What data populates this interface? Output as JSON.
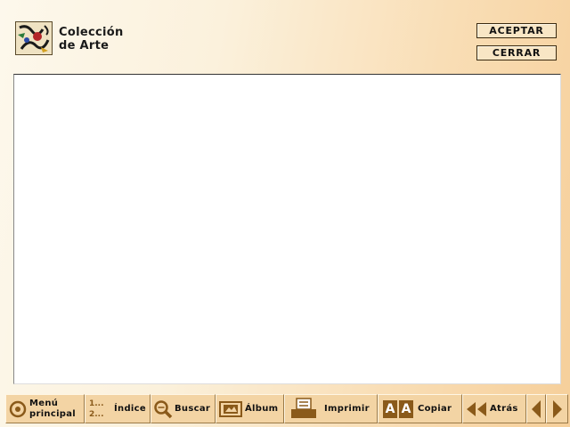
{
  "header": {
    "title_line1": "Colección",
    "title_line2": "de Arte",
    "accept_label": "ACEPTAR",
    "close_label": "CERRAR"
  },
  "toolbar": {
    "main_menu_line1": "Menú",
    "main_menu_line2": "principal",
    "index_icon_line1": "1...",
    "index_icon_line2": "2...",
    "index_label": "Índice",
    "search_label": "Buscar",
    "album_label": "Álbum",
    "print_label": "Imprimir",
    "copy_icon_letter": "A",
    "copy_label": "Copiar",
    "back_label": "Atrás"
  },
  "colors": {
    "button_face": "#f3d4a4",
    "icon_brown": "#8a5a1a",
    "background_light": "#fdf8ec",
    "background_dark": "#f6cf9a"
  }
}
